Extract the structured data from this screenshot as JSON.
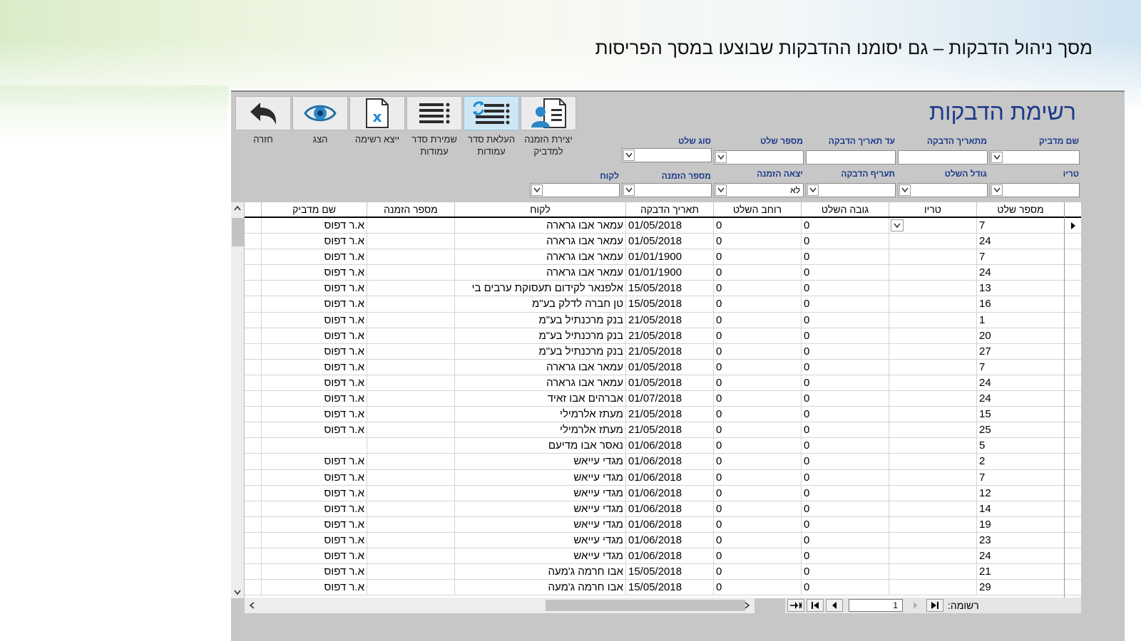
{
  "slide": {
    "title": "מסך ניהול הדבקות – גם יסומנו ההדבקות שבוצעו במסך הפריסות"
  },
  "form": {
    "title": "רשימת הדבקות"
  },
  "toolbar": [
    {
      "id": "create-order",
      "label": "יצירת הזמנה למדביק",
      "icon": "document-user-icon"
    },
    {
      "id": "load-columns",
      "label": "העלאת סדר עמודות",
      "icon": "list-refresh-icon",
      "active": true
    },
    {
      "id": "save-columns",
      "label": "שמירת סדר עמודות",
      "icon": "list-icon"
    },
    {
      "id": "export-list",
      "label": "ייצא רשימה",
      "icon": "excel-icon"
    },
    {
      "id": "view",
      "label": "הצג",
      "icon": "eye-icon"
    },
    {
      "id": "back",
      "label": "חזרה",
      "icon": "undo-icon"
    }
  ],
  "filters": {
    "row1": [
      {
        "label": "שם מדביק",
        "value": "",
        "dropdown": true
      },
      {
        "label": "מתאריך הדבקה",
        "value": "",
        "dropdown": false
      },
      {
        "label": "עד תאריך הדבקה",
        "value": "",
        "dropdown": false
      },
      {
        "label": "מספר שלט",
        "value": "",
        "dropdown": true
      },
      {
        "label": "סוג שלט",
        "value": "",
        "dropdown": true
      }
    ],
    "row2": [
      {
        "label": "טריו",
        "value": "",
        "dropdown": true
      },
      {
        "label": "גודל השלט",
        "value": "",
        "dropdown": true
      },
      {
        "label": "תעריף הדבקה",
        "value": "",
        "dropdown": true
      },
      {
        "label": "יצאה הזמנה",
        "value": "לא",
        "dropdown": true
      },
      {
        "label": "מספר הזמנה",
        "value": "",
        "dropdown": true
      },
      {
        "label": "לקוח",
        "value": "",
        "dropdown": true
      }
    ]
  },
  "grid": {
    "columns": [
      "מספר שלט",
      "טריו",
      "גובה השלט",
      "רוחב השלט",
      "תאריך הדבקה",
      "לקוח",
      "מספר הזמנה",
      "שם מדביק"
    ],
    "rows": [
      [
        "7",
        "",
        "0",
        "0",
        "01/05/2018",
        "עמאר אבו גרארה",
        "",
        "א.ר דפוס"
      ],
      [
        "24",
        "",
        "0",
        "0",
        "01/05/2018",
        "עמאר אבו גרארה",
        "",
        "א.ר דפוס"
      ],
      [
        "7",
        "",
        "0",
        "0",
        "01/01/1900",
        "עמאר אבו גרארה",
        "",
        "א.ר דפוס"
      ],
      [
        "24",
        "",
        "0",
        "0",
        "01/01/1900",
        "עמאר אבו גרארה",
        "",
        "א.ר דפוס"
      ],
      [
        "13",
        "",
        "0",
        "0",
        "15/05/2018",
        "אלפנאר לקידום תעסוקת ערבים בי",
        "",
        "א.ר דפוס"
      ],
      [
        "16",
        "",
        "0",
        "0",
        "15/05/2018",
        "טן חברה לדלק בע\"מ",
        "",
        "א.ר דפוס"
      ],
      [
        "1",
        "",
        "0",
        "0",
        "21/05/2018",
        "בנק מרכנתיל בע\"מ",
        "",
        "א.ר דפוס"
      ],
      [
        "20",
        "",
        "0",
        "0",
        "21/05/2018",
        "בנק מרכנתיל בע\"מ",
        "",
        "א.ר דפוס"
      ],
      [
        "27",
        "",
        "0",
        "0",
        "21/05/2018",
        "בנק מרכנתיל בע\"מ",
        "",
        "א.ר דפוס"
      ],
      [
        "7",
        "",
        "0",
        "0",
        "01/05/2018",
        "עמאר אבו גרארה",
        "",
        "א.ר דפוס"
      ],
      [
        "24",
        "",
        "0",
        "0",
        "01/05/2018",
        "עמאר אבו גרארה",
        "",
        "א.ר דפוס"
      ],
      [
        "24",
        "",
        "0",
        "0",
        "01/07/2018",
        "אברהים אבו זאיד",
        "",
        "א.ר דפוס"
      ],
      [
        "15",
        "",
        "0",
        "0",
        "21/05/2018",
        "מעתז אלרמילי",
        "",
        "א.ר דפוס"
      ],
      [
        "25",
        "",
        "0",
        "0",
        "21/05/2018",
        "מעתז אלרמילי",
        "",
        "א.ר דפוס"
      ],
      [
        "5",
        "",
        "0",
        "0",
        "01/06/2018",
        "נאסר אבו מדיעם",
        "",
        ""
      ],
      [
        "2",
        "",
        "0",
        "0",
        "01/06/2018",
        "מגדי עייאש",
        "",
        "א.ר דפוס"
      ],
      [
        "7",
        "",
        "0",
        "0",
        "01/06/2018",
        "מגדי עייאש",
        "",
        "א.ר דפוס"
      ],
      [
        "12",
        "",
        "0",
        "0",
        "01/06/2018",
        "מגדי עייאש",
        "",
        "א.ר דפוס"
      ],
      [
        "14",
        "",
        "0",
        "0",
        "01/06/2018",
        "מגדי עייאש",
        "",
        "א.ר דפוס"
      ],
      [
        "19",
        "",
        "0",
        "0",
        "01/06/2018",
        "מגדי עייאש",
        "",
        "א.ר דפוס"
      ],
      [
        "23",
        "",
        "0",
        "0",
        "01/06/2018",
        "מגדי עייאש",
        "",
        "א.ר דפוס"
      ],
      [
        "24",
        "",
        "0",
        "0",
        "01/06/2018",
        "מגדי עייאש",
        "",
        "א.ר דפוס"
      ],
      [
        "21",
        "",
        "0",
        "0",
        "15/05/2018",
        "אבו חרמה ג'מעה",
        "",
        "א.ר דפוס"
      ],
      [
        "29",
        "",
        "0",
        "0",
        "15/05/2018",
        "אבו חרמה ג'מעה",
        "",
        "א.ר דפוס"
      ]
    ]
  },
  "navigation": {
    "label": "רשומה:",
    "current": "1"
  }
}
